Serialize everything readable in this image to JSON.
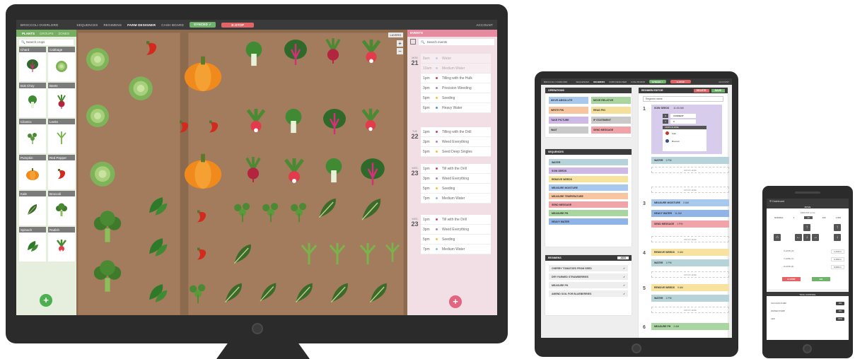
{
  "desktop": {
    "nav": {
      "brand": "BROCCOLI OVERLORD",
      "links": [
        "SEQUENCES",
        "REGIMENS",
        "FARM DESIGNER",
        "CASH BOARD"
      ],
      "active": "FARM DESIGNER",
      "synced": "SYNCED ✓",
      "estop": "E-STOP",
      "account": "ACCOUNT"
    },
    "plants_panel": {
      "tabs": [
        "PLANTS",
        "GROUPS",
        "ZONES"
      ],
      "search_placeholder": "Search crops",
      "crops": [
        {
          "name": "Chard",
          "icon": "chard-icon"
        },
        {
          "name": "Cabbage",
          "icon": "cabbage-icon"
        },
        {
          "name": "Bok Choy",
          "icon": "bok-choy-icon"
        },
        {
          "name": "Beets",
          "icon": "beet-icon"
        },
        {
          "name": "Cilantro",
          "icon": "cilantro-icon"
        },
        {
          "name": "Leeks",
          "icon": "leek-icon"
        },
        {
          "name": "Pumpkin",
          "icon": "pumpkin-icon"
        },
        {
          "name": "Red Pepper",
          "icon": "red-pepper-icon"
        },
        {
          "name": "Kale",
          "icon": "kale-icon"
        },
        {
          "name": "Broccoli",
          "icon": "broccoli-icon"
        },
        {
          "name": "Spinach",
          "icon": "spinach-icon"
        },
        {
          "name": "Radish",
          "icon": "radish-icon"
        }
      ],
      "add": "+"
    },
    "map": {
      "layers": "LAYERS",
      "zoom_in": "+",
      "zoom_out": "−"
    },
    "events": {
      "header": "EVENTS",
      "search_placeholder": "Search events",
      "add": "+",
      "days": [
        {
          "dow": "MON",
          "day": "21",
          "items": [
            {
              "time": "8am",
              "title": "Water",
              "color": "#8fb8e8",
              "faded": true
            },
            {
              "time": "10am",
              "title": "Medium Water",
              "color": "#8fb8e8",
              "faded": true
            },
            {
              "time": "1pm",
              "title": "Tilling with the Hulk",
              "color": "#d04060",
              "faded": false
            },
            {
              "time": "3pm",
              "title": "Precision Weeding",
              "color": "#b97ad0",
              "faded": false
            },
            {
              "time": "5pm",
              "title": "Seeding",
              "color": "#f0c040",
              "faded": false
            },
            {
              "time": "6pm",
              "title": "Heavy Water",
              "color": "#5a8fd8",
              "faded": false
            }
          ]
        },
        {
          "dow": "TUE",
          "day": "22",
          "items": [
            {
              "time": "1pm",
              "title": "Tilling with the Drill",
              "color": "#d04060",
              "faded": false
            },
            {
              "time": "3pm",
              "title": "Weed Everything",
              "color": "#b97ad0",
              "faded": false
            },
            {
              "time": "5pm",
              "title": "Seed Deep Singles",
              "color": "#f0c040",
              "faded": false
            }
          ]
        },
        {
          "dow": "WED",
          "day": "23",
          "items": [
            {
              "time": "1pm",
              "title": "Till with the Drill",
              "color": "#d04060",
              "faded": false
            },
            {
              "time": "3pm",
              "title": "Weed Everything",
              "color": "#b97ad0",
              "faded": false
            },
            {
              "time": "5pm",
              "title": "Seeding",
              "color": "#f0c040",
              "faded": false
            },
            {
              "time": "7pm",
              "title": "Medium Water",
              "color": "#8fb8e8",
              "faded": false
            }
          ]
        },
        {
          "dow": "WED",
          "day": "23",
          "items": [
            {
              "time": "1pm",
              "title": "Till with the Drill",
              "color": "#d04060",
              "faded": false
            },
            {
              "time": "3pm",
              "title": "Weed Everything",
              "color": "#b97ad0",
              "faded": false
            },
            {
              "time": "5pm",
              "title": "Seeding",
              "color": "#f0c040",
              "faded": false
            },
            {
              "time": "7pm",
              "title": "Medium Water",
              "color": "#8fb8e8",
              "faded": false
            }
          ]
        }
      ]
    }
  },
  "tablet": {
    "nav": {
      "brand": "BROCCOLI OVERLORD",
      "links": [
        "SEQUENCES",
        "REGIMENS",
        "FARM DESIGNER",
        "CASH BOARD"
      ],
      "active": "REGIMENS",
      "synced": "SYNCED ✓",
      "estop": "E-STOP",
      "account": "ACCOUNT"
    },
    "operations": {
      "header": "OPERATIONS",
      "commands": [
        {
          "label": "MOVE ABSOLUTE",
          "color": "#a9c8ee"
        },
        {
          "label": "MOVE RELATIVE",
          "color": "#a8d5a0"
        },
        {
          "label": "WRITE PIN",
          "color": "#f7c6a0"
        },
        {
          "label": "READ PIN",
          "color": "#f4e09a"
        },
        {
          "label": "TAKE PICTURE",
          "color": "#cdb8e6"
        },
        {
          "label": "IF STATEMENT",
          "color": "#c9c9c9"
        },
        {
          "label": "WAIT",
          "color": "#c9c9c9"
        },
        {
          "label": "SEND MESSAGE",
          "color": "#f0a3a8"
        }
      ]
    },
    "sequences": {
      "header": "SEQUENCES",
      "items": [
        {
          "label": "WATER",
          "color": "#b5d3d8"
        },
        {
          "label": "SOW SEEDS",
          "color": "#cdb8e6"
        },
        {
          "label": "REMOVE WEEDS",
          "color": "#f7e39f"
        },
        {
          "label": "MEASURE MOISTURE",
          "color": "#a9c8ee"
        },
        {
          "label": "MEASURE TEMPERATURE",
          "color": "#f7c6a0"
        },
        {
          "label": "SEND MESSAGE",
          "color": "#f0a3a8"
        },
        {
          "label": "MEASURE PH",
          "color": "#a8d5a0"
        },
        {
          "label": "HEAVY WATER",
          "color": "#8fb4e8"
        }
      ]
    },
    "regimens": {
      "header": "REGIMENS",
      "add": "ADD",
      "items": [
        "CHERRY TOMATOES FROM SEED",
        "DRY FARMED STRAWBERRIES",
        "MEASURE PH",
        "AMEND SOIL FOR BLUEBERRIES"
      ]
    },
    "editor": {
      "header": "REGIMEN EDITOR",
      "delete": "DELETE",
      "save": "SAVE",
      "name": "Regimen name",
      "drop": "DROP HERE",
      "step1_title": "SOW SEEDS",
      "step1_time": "11:00 AM",
      "step1_fields": [
        "X",
        "Y"
      ],
      "step1_values": [
        "CURRENT",
        "0"
      ],
      "step1_subhead": "CROPS IN ZONE",
      "step1_crops": [
        "Kale",
        "Broccoli"
      ],
      "steps": [
        {
          "day": "1",
          "label": "WATER",
          "time": "1 PM",
          "color": "#b5d3d8"
        },
        {
          "day": "3",
          "label": "MEASURE MOISTURE",
          "time": "2 AM",
          "color": "#a9c8ee"
        },
        {
          "day": "3",
          "label": "HEAVY WATER",
          "time": "11 AM",
          "color": "#8fb4e8"
        },
        {
          "day": "3",
          "label": "SEND MESSAGE",
          "time": "1 PM",
          "color": "#f0a3a8"
        },
        {
          "day": "4",
          "label": "REMOVE WEEDS",
          "time": "9 AM",
          "color": "#f7e39f"
        },
        {
          "day": "4",
          "label": "WATER",
          "time": "1 PM",
          "color": "#b5d3d8"
        },
        {
          "day": "5",
          "label": "REMOVE WEEDS",
          "time": "9 AM",
          "color": "#f7e39f"
        },
        {
          "day": "5",
          "label": "WATER",
          "time": "1 PM",
          "color": "#b5d3d8"
        },
        {
          "day": "6",
          "label": "MEASURE PH",
          "time": "2 AM",
          "color": "#a8d5a0"
        }
      ]
    }
  },
  "phone": {
    "title": "Dashboard",
    "move": {
      "header": "MOVE",
      "amount_label": "AMOUNT (mm)",
      "amounts": [
        "NORMAL",
        "1",
        "10",
        "100",
        "1,000"
      ],
      "selected": "10",
      "readouts": [
        {
          "label": "X-AXIS (X)",
          "value": "1,210 m"
        },
        {
          "label": "Y-AXIS (Y)",
          "value": "0,150 m"
        },
        {
          "label": "Z-AXIS (Z)",
          "value": "0,000 m"
        }
      ],
      "estop": "E-STOP",
      "go": "GO"
    },
    "tools": {
      "header": "TOOL CONTROL",
      "items": [
        {
          "label": "VACUUM PUMP",
          "state": "ON"
        },
        {
          "label": "WATER PUMP",
          "state": "ON"
        },
        {
          "label": "LED",
          "state": "OFF"
        }
      ]
    }
  }
}
